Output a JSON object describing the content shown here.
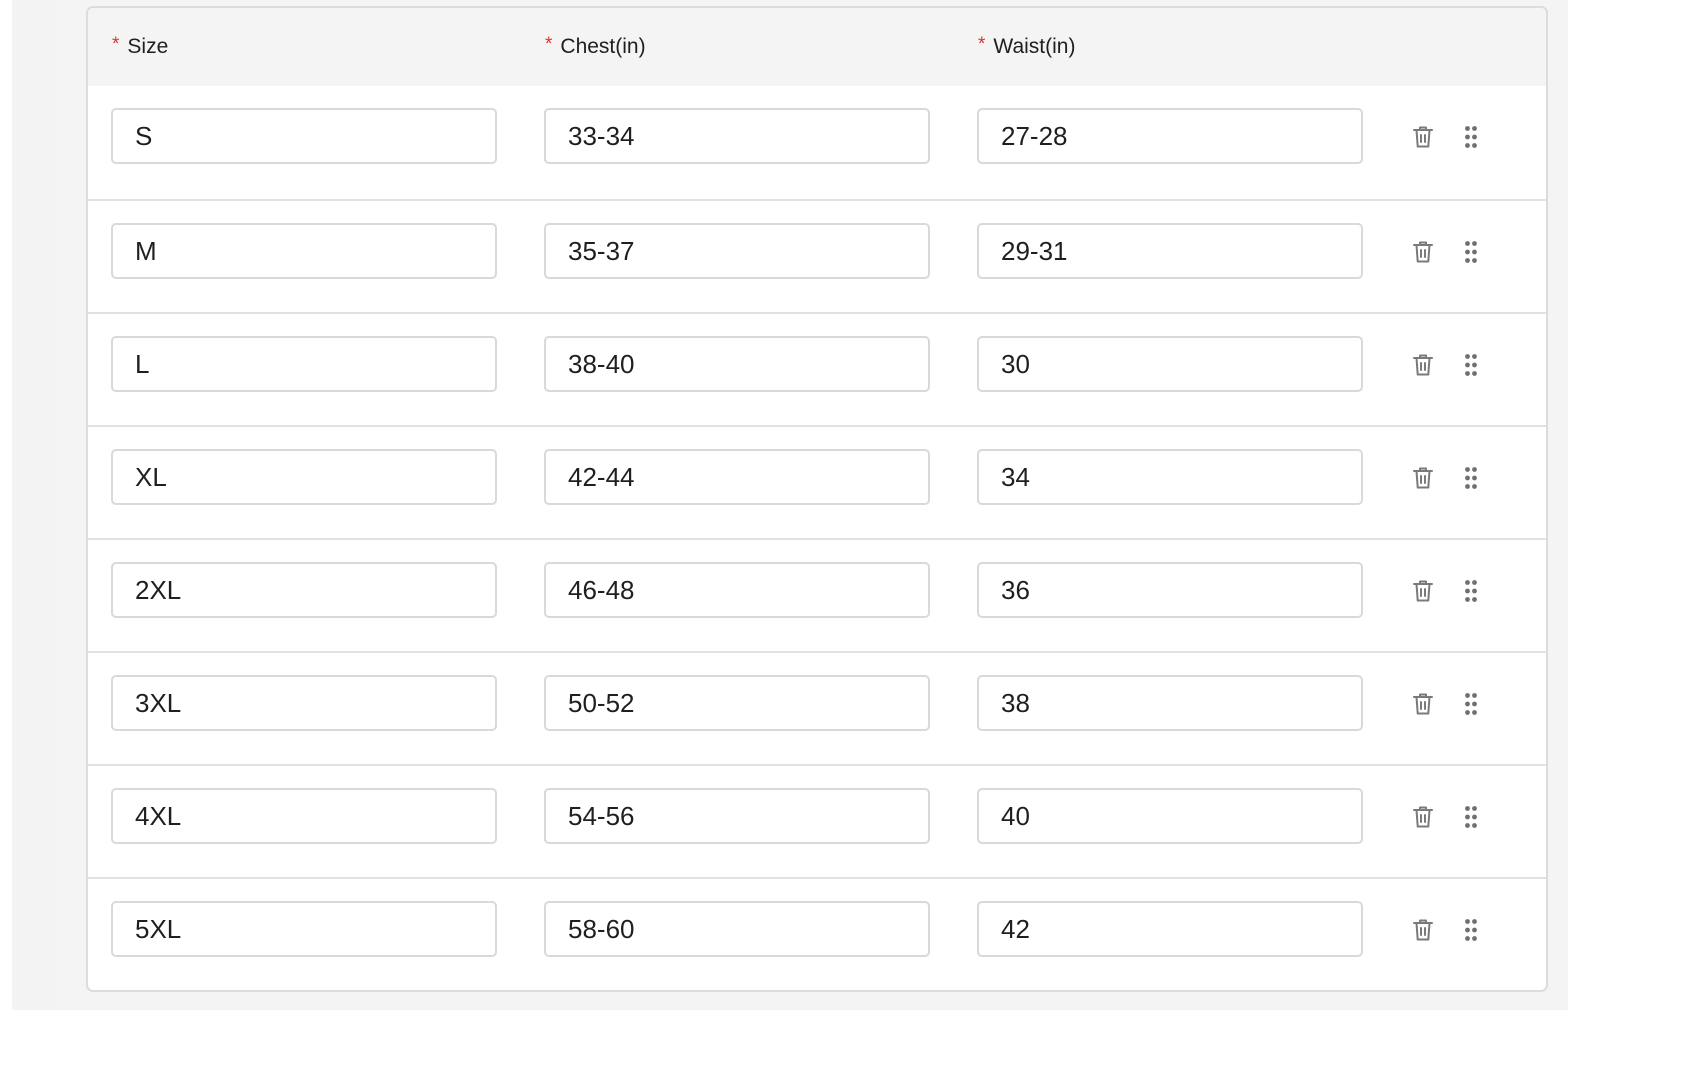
{
  "table": {
    "headers": {
      "size": "Size",
      "chest": "Chest(in)",
      "waist": "Waist(in)",
      "required_marker": "*"
    },
    "rows": [
      {
        "size": "S",
        "chest": "33-34",
        "waist": "27-28"
      },
      {
        "size": "M",
        "chest": "35-37",
        "waist": "29-31"
      },
      {
        "size": "L",
        "chest": "38-40",
        "waist": "30"
      },
      {
        "size": "XL",
        "chest": "42-44",
        "waist": "34"
      },
      {
        "size": "2XL",
        "chest": "46-48",
        "waist": "36"
      },
      {
        "size": "3XL",
        "chest": "50-52",
        "waist": "38"
      },
      {
        "size": "4XL",
        "chest": "54-56",
        "waist": "40"
      },
      {
        "size": "5XL",
        "chest": "58-60",
        "waist": "42"
      }
    ],
    "row_actions": [
      "trash-icon",
      "drag-handle-icon"
    ]
  },
  "colors": {
    "required": "#e0352b",
    "header_bg": "#f4f4f4",
    "border": "#d9d9d9",
    "icon": "#7a7a7a"
  }
}
